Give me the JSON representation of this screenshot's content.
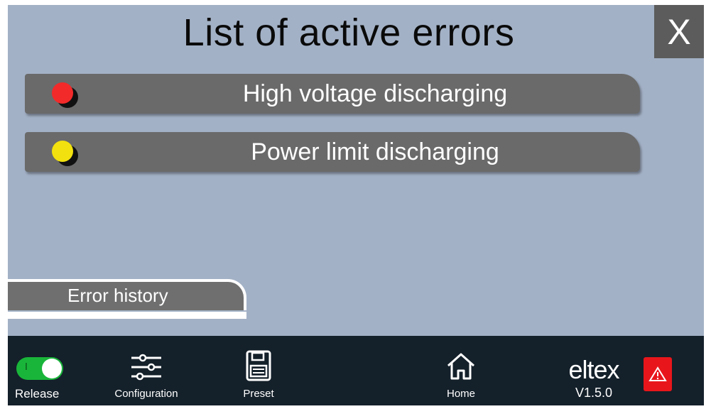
{
  "header": {
    "title": "List of active errors",
    "close_label": "X"
  },
  "errors": [
    {
      "label": "High voltage discharging",
      "led_color": "#f22a2a",
      "severity": "red"
    },
    {
      "label": "Power limit discharging",
      "led_color": "#f2e10f",
      "severity": "yellow"
    }
  ],
  "history_tab": {
    "label": "Error history"
  },
  "bottom_bar": {
    "release": {
      "label": "Release",
      "toggle_mark": "I",
      "state": "on"
    },
    "configuration": {
      "label": "Configuration",
      "icon": "sliders-icon"
    },
    "preset": {
      "label": "Preset",
      "icon": "floppy-disk-icon"
    },
    "home": {
      "label": "Home",
      "icon": "home-icon"
    },
    "brand": {
      "logo": "eltex",
      "version": "V1.5.0"
    },
    "alarm": {
      "icon": "warning-icon"
    }
  },
  "colors": {
    "screen_background": "#a3b1c6",
    "row_background": "#6a6a6a",
    "bottom_bar": "#14202a",
    "toggle_on": "#19b53a",
    "alarm": "#e8161b"
  }
}
